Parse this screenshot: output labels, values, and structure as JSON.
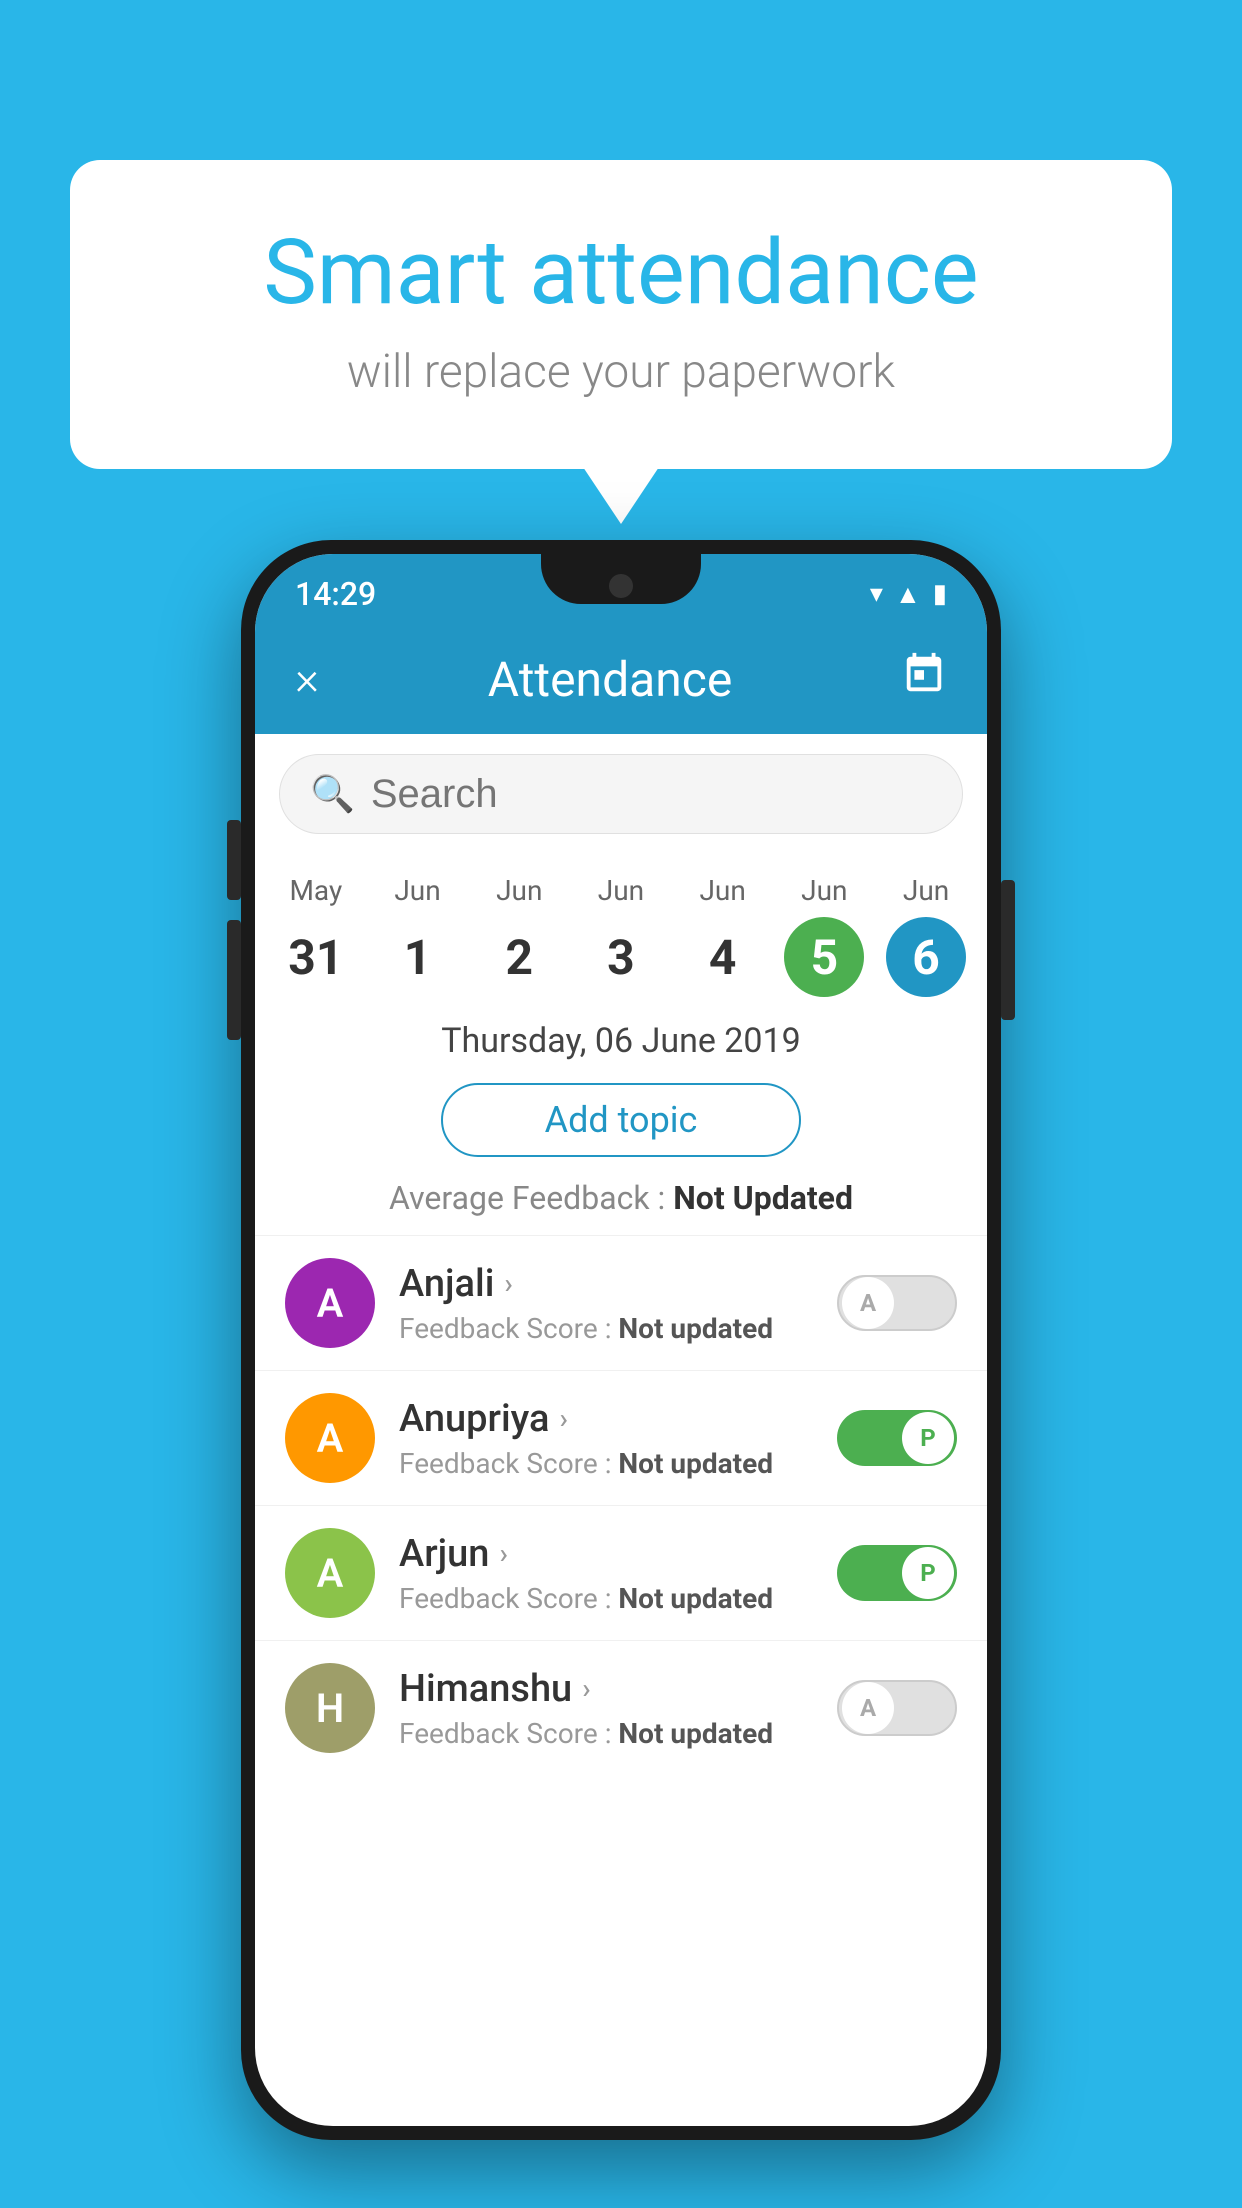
{
  "background_color": "#29b6e8",
  "speech_bubble": {
    "title": "Smart attendance",
    "subtitle": "will replace your paperwork"
  },
  "status_bar": {
    "time": "14:29",
    "icons": [
      "wifi",
      "signal",
      "battery"
    ]
  },
  "app_bar": {
    "close_icon": "×",
    "title": "Attendance",
    "calendar_icon": "📅"
  },
  "search": {
    "placeholder": "Search"
  },
  "calendar": {
    "days": [
      {
        "month": "May",
        "date": "31",
        "style": "normal"
      },
      {
        "month": "Jun",
        "date": "1",
        "style": "normal"
      },
      {
        "month": "Jun",
        "date": "2",
        "style": "normal"
      },
      {
        "month": "Jun",
        "date": "3",
        "style": "normal"
      },
      {
        "month": "Jun",
        "date": "4",
        "style": "normal"
      },
      {
        "month": "Jun",
        "date": "5",
        "style": "today"
      },
      {
        "month": "Jun",
        "date": "6",
        "style": "selected"
      }
    ],
    "selected_date_label": "Thursday, 06 June 2019"
  },
  "add_topic": {
    "label": "Add topic"
  },
  "average_feedback": {
    "label": "Average Feedback :",
    "value": "Not Updated"
  },
  "students": [
    {
      "name": "Anjali",
      "avatar_letter": "A",
      "avatar_color": "purple",
      "feedback_label": "Feedback Score :",
      "feedback_value": "Not updated",
      "toggle": "off",
      "toggle_letter": "A"
    },
    {
      "name": "Anupriya",
      "avatar_letter": "A",
      "avatar_color": "orange",
      "feedback_label": "Feedback Score :",
      "feedback_value": "Not updated",
      "toggle": "on",
      "toggle_letter": "P"
    },
    {
      "name": "Arjun",
      "avatar_letter": "A",
      "avatar_color": "light-green",
      "feedback_label": "Feedback Score :",
      "feedback_value": "Not updated",
      "toggle": "on",
      "toggle_letter": "P"
    },
    {
      "name": "Himanshu",
      "avatar_letter": "H",
      "avatar_color": "olive",
      "feedback_label": "Feedback Score :",
      "feedback_value": "Not updated",
      "toggle": "off",
      "toggle_letter": "A"
    }
  ]
}
